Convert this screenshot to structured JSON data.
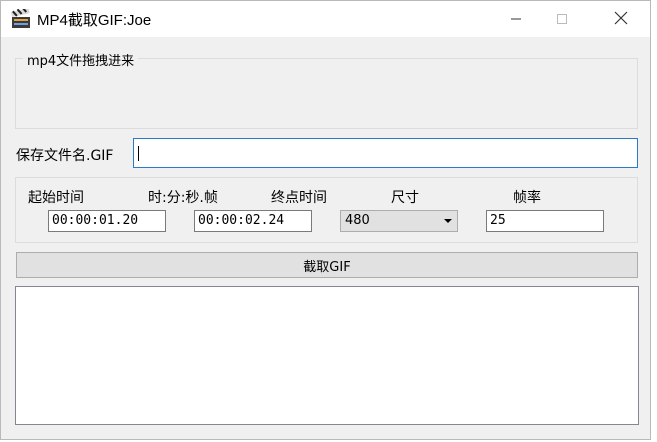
{
  "window": {
    "title": "MP4截取GIF:Joe"
  },
  "dropzone": {
    "title": "mp4文件拖拽进来"
  },
  "save": {
    "label": "保存文件名.GIF",
    "value": ""
  },
  "params": {
    "start_label": "起始时间",
    "format_label": "时:分:秒.帧",
    "end_label": "终点时间",
    "size_label": "尺寸",
    "fps_label": "帧率",
    "start_value": "00:00:01.20",
    "end_value": "00:00:02.24",
    "size_value": "480",
    "fps_value": "25"
  },
  "actions": {
    "capture_label": "截取GIF"
  },
  "log": {
    "text": ""
  },
  "icons": {
    "app": "clapperboard-icon",
    "minimize": "minimize-icon",
    "maximize": "maximize-icon",
    "close": "close-icon"
  }
}
